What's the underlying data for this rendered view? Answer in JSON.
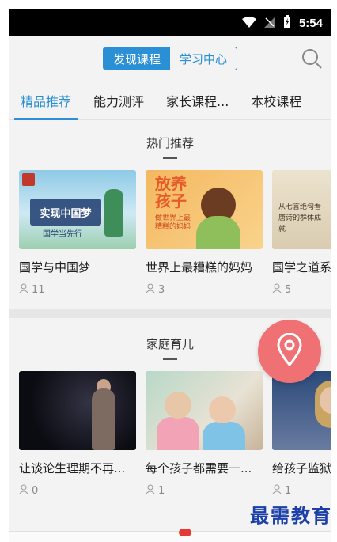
{
  "status_bar": {
    "time": "5:54"
  },
  "header": {
    "segments": [
      "发现课程",
      "学习中心"
    ],
    "active_segment": 0
  },
  "tabs": [
    "精品推荐",
    "能力测评",
    "家长课程...",
    "本校课程"
  ],
  "sections": [
    {
      "title": "热门推荐",
      "cards": [
        {
          "title": "国学与中国梦",
          "count": "11",
          "thumb_text": "实现中国梦",
          "thumb_sub": "国学当先行"
        },
        {
          "title": "世界上最糟糕的妈妈",
          "count": "3",
          "thumb_text": "放养孩子",
          "thumb_sub": "做世界上最糟糕的妈妈"
        },
        {
          "title": "国学之道系",
          "count": "5",
          "thumb_text": "从七言绝句看唐诗的群体成就"
        }
      ]
    },
    {
      "title": "家庭育儿",
      "cards": [
        {
          "title": "让谈论生理期不再...",
          "count": "0"
        },
        {
          "title": "每个孩子都需要一...",
          "count": "1"
        },
        {
          "title": "给孩子监狱",
          "count": "1"
        }
      ]
    }
  ],
  "watermark": "最需教育",
  "colors": {
    "accent": "#2a8fd4",
    "fab": "#f07174",
    "badge": "#e53935"
  }
}
